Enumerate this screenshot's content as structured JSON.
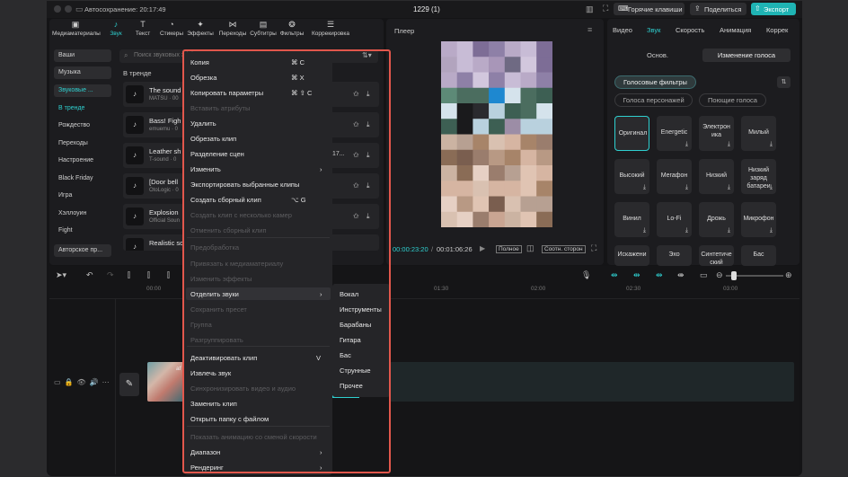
{
  "titlebar": {
    "autosave": "Автосохранение: 20:17:49",
    "project": "1229 (1)",
    "hotkeys": "Горячие клавиши",
    "share": "Поделиться",
    "export": "Экспорт"
  },
  "toolbar": [
    {
      "label": "Медиаматериалы",
      "icon": "media-icon"
    },
    {
      "label": "Звук",
      "icon": "audio-icon"
    },
    {
      "label": "Текст",
      "icon": "text-icon"
    },
    {
      "label": "Стикеры",
      "icon": "sticker-icon"
    },
    {
      "label": "Эффекты",
      "icon": "effects-icon"
    },
    {
      "label": "Переходы",
      "icon": "transitions-icon"
    },
    {
      "label": "Субтитры",
      "icon": "subtitles-icon"
    },
    {
      "label": "Фильтры",
      "icon": "filters-icon"
    },
    {
      "label": "Коррекировка",
      "icon": "adjust-icon"
    }
  ],
  "sidebar": {
    "items": [
      "Ваши",
      "Музыка",
      "Звуковые ...",
      "В тренде",
      "Рождество",
      "Переходы",
      "Настроение",
      "Black Friday",
      "Игра",
      "Хэллоуин",
      "Fight",
      "Авторское пр..."
    ],
    "search_placeholder": "Поиск звуковых эфф",
    "section": "В тренде"
  },
  "tracks": [
    {
      "title": "The sound",
      "sub": "MATSU · 00"
    },
    {
      "title": "Bass! Figh",
      "sub": "emuemu · 0"
    },
    {
      "title": "Leather sh",
      "sub": "T-sound · 0",
      "extra": "17..."
    },
    {
      "title": "[Door bell",
      "sub": "OtoLogic · 0"
    },
    {
      "title": "Explosion",
      "sub": "Official Soun"
    },
    {
      "title": "Realistic sc",
      "sub": ""
    }
  ],
  "context_menu": {
    "items": [
      {
        "label": "Копия",
        "shortcut": "⌘  C",
        "disabled": false
      },
      {
        "label": "Обрезка",
        "shortcut": "⌘  X",
        "disabled": false
      },
      {
        "label": "Копировать параметры",
        "shortcut": "⌘ ⇧ C",
        "disabled": false
      },
      {
        "label": "Вставить атрибуты",
        "shortcut": "",
        "disabled": true
      },
      {
        "label": "Удалить",
        "shortcut": "",
        "disabled": false
      },
      {
        "label": "Обрезать клип",
        "shortcut": "",
        "disabled": false
      },
      {
        "label": "Разделение сцен",
        "shortcut": "",
        "disabled": false
      },
      {
        "label": "Изменить",
        "shortcut": "›",
        "disabled": false
      },
      {
        "label": "Экспортировать выбранные клипы",
        "shortcut": "",
        "disabled": false
      },
      {
        "label": "Создать сборный клип",
        "shortcut": "⌥  G",
        "disabled": false
      },
      {
        "label": "Создать клип с несколько камер",
        "shortcut": "",
        "disabled": true
      },
      {
        "label": "Отменить сборный клип",
        "shortcut": "",
        "disabled": true
      },
      {
        "label": "Предобработка",
        "shortcut": "",
        "disabled": true
      },
      {
        "label": "Привязать к медиаматериалу",
        "shortcut": "",
        "disabled": true
      },
      {
        "label": "Изменить эффекты",
        "shortcut": "",
        "disabled": true
      },
      {
        "label": "Отделить звуки",
        "shortcut": "›",
        "disabled": false
      },
      {
        "label": "Сохранить пресет",
        "shortcut": "",
        "disabled": true
      },
      {
        "label": "Группа",
        "shortcut": "",
        "disabled": true
      },
      {
        "label": "Разгруппировать",
        "shortcut": "",
        "disabled": true
      },
      {
        "label": "Деактивировать клип",
        "shortcut": "V",
        "disabled": false
      },
      {
        "label": "Извлечь звук",
        "shortcut": "",
        "disabled": false
      },
      {
        "label": "Синхронизировать видео и аудио",
        "shortcut": "",
        "disabled": true
      },
      {
        "label": "Заменить клип",
        "shortcut": "",
        "disabled": false
      },
      {
        "label": "Открыть папку с файлом",
        "shortcut": "",
        "disabled": false
      },
      {
        "label": "Показать анимацию со сменой скорости",
        "shortcut": "",
        "disabled": true
      },
      {
        "label": "Диапазон",
        "shortcut": "›",
        "disabled": false
      },
      {
        "label": "Рендеринг",
        "shortcut": "›",
        "disabled": false
      }
    ]
  },
  "submenu": {
    "items": [
      "Вокал",
      "Инструменты",
      "Барабаны",
      "Гитара",
      "Бас",
      "Струнные",
      "Прочее"
    ]
  },
  "player": {
    "title": "Плеер",
    "current": "00:00:23:20",
    "duration": "00:01:06:26",
    "full": "Полное",
    "ratio": "Соотн. сторон"
  },
  "right_panel": {
    "tabs": [
      "Видео",
      "Звук",
      "Скорость",
      "Анимация",
      "Коррек"
    ],
    "subtabs": [
      "Основ.",
      "Изменение голоса"
    ],
    "filter_chips": [
      "Голосовые фильтры",
      "Голоса персонажей",
      "Поющие голоса"
    ],
    "presets": [
      "Оригинал",
      "Energetic",
      "Электрон ика",
      "Милый",
      "Высокий",
      "Мегафон",
      "Низкий",
      "Низкий заряд батареи",
      "Винил",
      "Lo-Fi",
      "Дрожь",
      "Микрофон",
      "Искажени",
      "Эхо",
      "Синтетиче ский",
      "Бас"
    ]
  },
  "timeline": {
    "ticks": [
      "00:00",
      "01:30",
      "02:00",
      "02:30",
      "03:00"
    ]
  },
  "colors": {
    "accent": "#2fd0d0",
    "highlight": "#e2574c",
    "export": "#1fb3b3"
  }
}
